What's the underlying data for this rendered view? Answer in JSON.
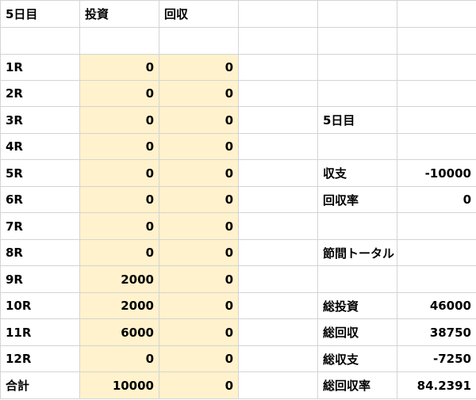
{
  "sheet": {
    "header": {
      "c0": "5日目",
      "c1": "投資",
      "c2": "回収"
    },
    "races": [
      {
        "label": "1R",
        "invest": "0",
        "payout": "0"
      },
      {
        "label": "2R",
        "invest": "0",
        "payout": "0"
      },
      {
        "label": "3R",
        "invest": "0",
        "payout": "0"
      },
      {
        "label": "4R",
        "invest": "0",
        "payout": "0"
      },
      {
        "label": "5R",
        "invest": "0",
        "payout": "0"
      },
      {
        "label": "6R",
        "invest": "0",
        "payout": "0"
      },
      {
        "label": "7R",
        "invest": "0",
        "payout": "0"
      },
      {
        "label": "8R",
        "invest": "0",
        "payout": "0"
      },
      {
        "label": "9R",
        "invest": "2000",
        "payout": "0"
      },
      {
        "label": "10R",
        "invest": "2000",
        "payout": "0"
      },
      {
        "label": "11R",
        "invest": "6000",
        "payout": "0"
      },
      {
        "label": "12R",
        "invest": "0",
        "payout": "0"
      }
    ],
    "total": {
      "label": "合計",
      "invest": "10000",
      "payout": "0"
    },
    "highlight_color": "#fff2cc",
    "summary": {
      "day_title": "5日目",
      "balance_label": "収支",
      "balance_value": "-10000",
      "return_rate_label": "回収率",
      "return_rate_value": "0",
      "section_title": "節間トータル",
      "total_invest_label": "総投資",
      "total_invest_value": "46000",
      "total_payout_label": "総回収",
      "total_payout_value": "38750",
      "total_balance_label": "総収支",
      "total_balance_value": "-7250",
      "total_return_rate_label": "総回収率",
      "total_return_rate_value": "84.2391"
    }
  }
}
